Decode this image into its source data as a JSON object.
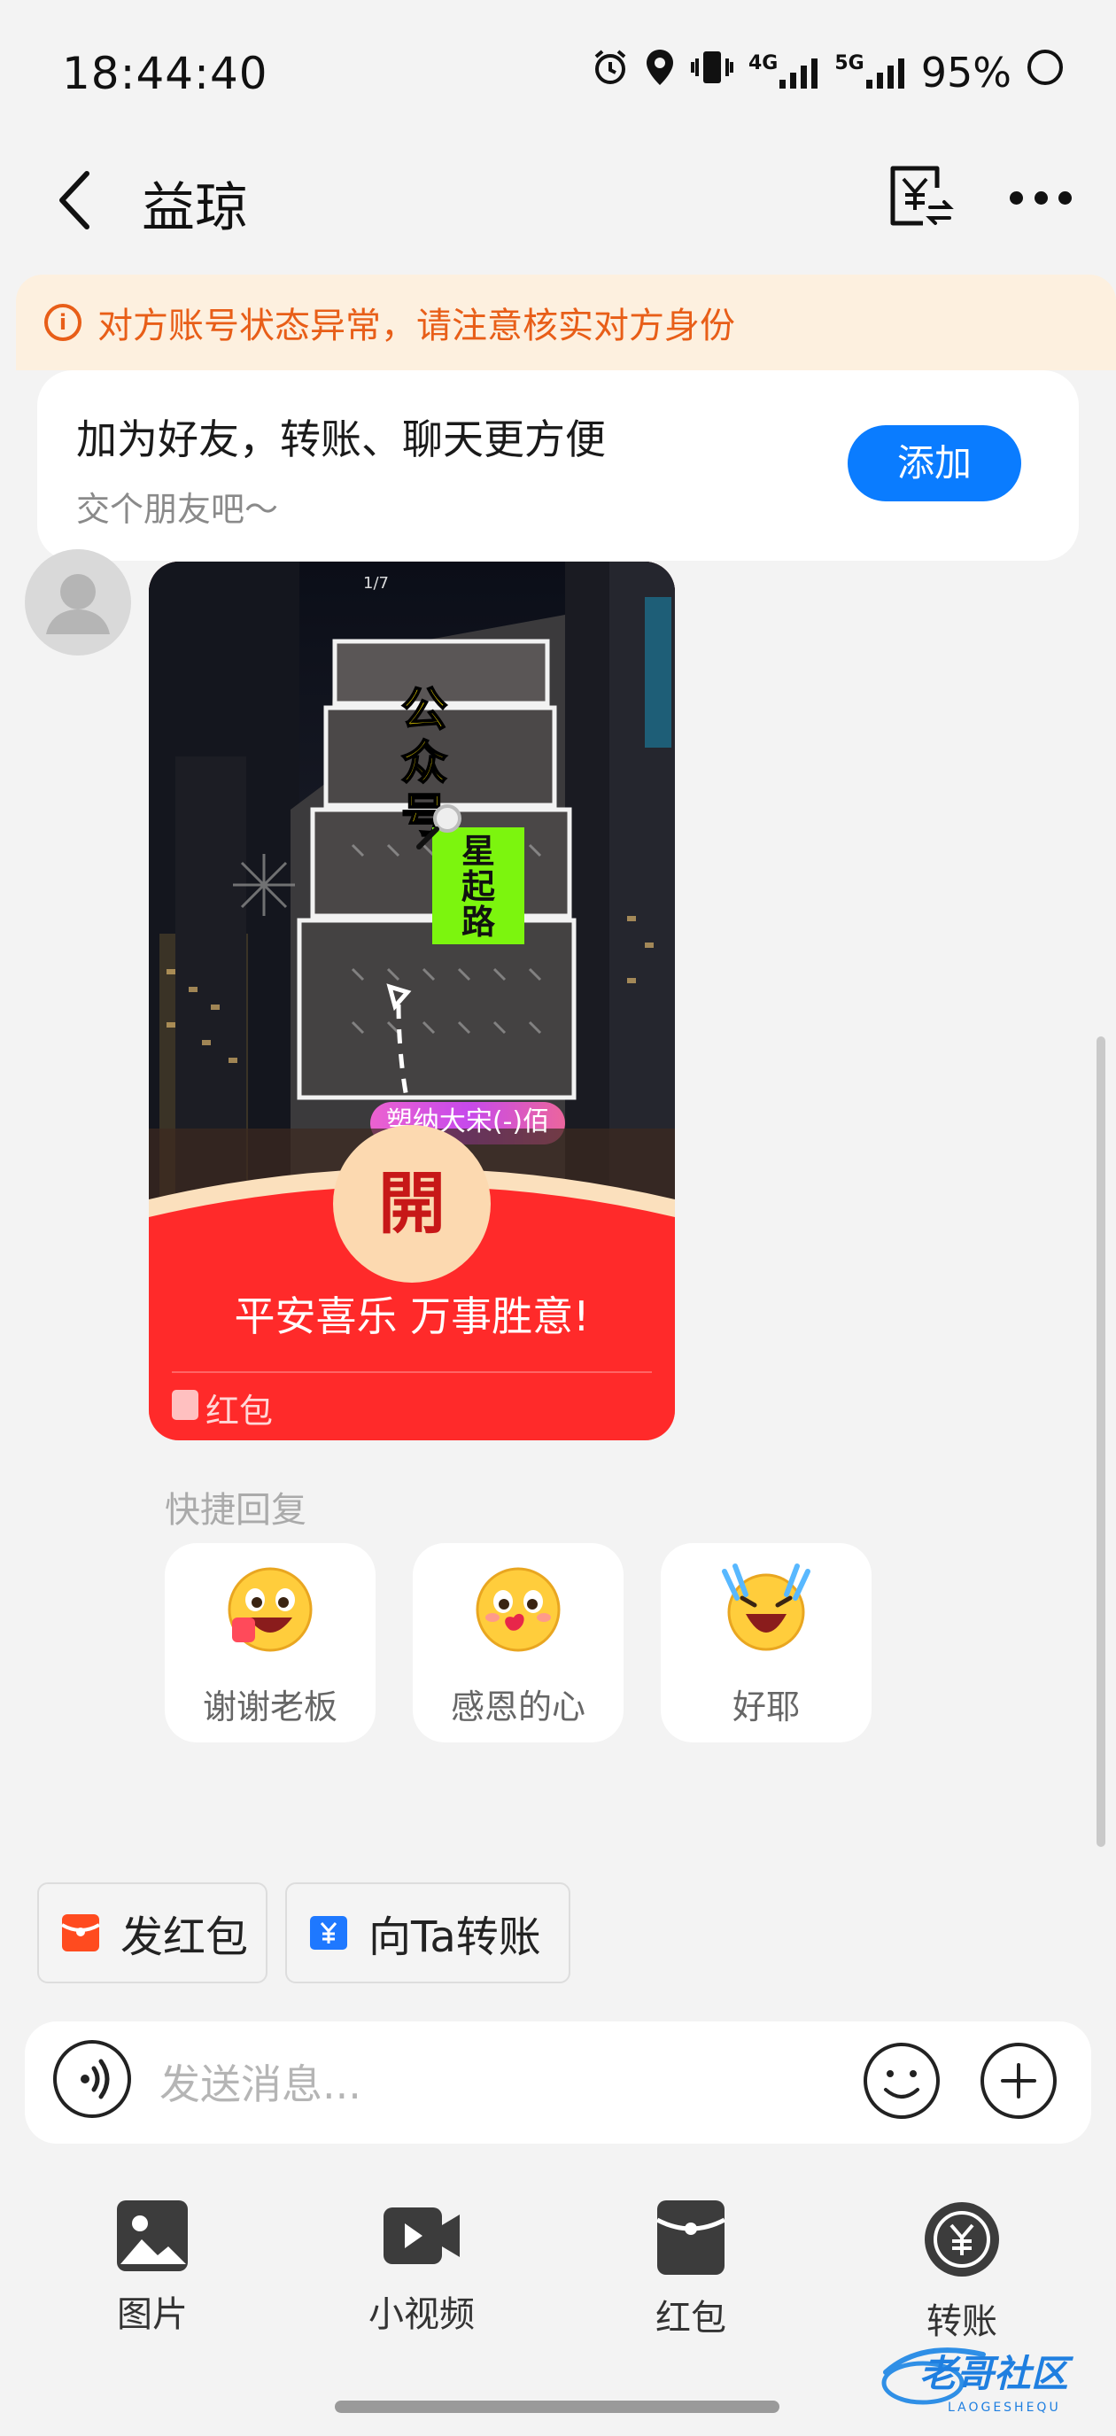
{
  "status_bar": {
    "time": "18:44:40",
    "battery_percent": "95%",
    "network_1": "4G",
    "network_2": "5G",
    "icons": [
      "alarm-icon",
      "location-icon",
      "vibrate-icon",
      "signal-4g-icon",
      "signal-5g-icon",
      "battery-icon"
    ]
  },
  "header": {
    "title": "益琼",
    "icons": [
      "back-arrow-icon",
      "transfer-receipt-icon",
      "more-dots-icon"
    ]
  },
  "warning": {
    "text": "对方账号状态异常，请注意核实对方身份",
    "icon_glyph": "i",
    "color": "#e85e18"
  },
  "friend_card": {
    "title": "加为好友，转账、聊天更方便",
    "subtitle": "交个朋友吧～",
    "button": "添加",
    "button_color": "#0a7cff"
  },
  "red_packet": {
    "page_indicator": "1/7",
    "overlay_vertical_1": "公众号",
    "overlay_vertical_2": "星起路",
    "neon_text": "塑纳大宋(-)佰",
    "open_glyph": "開",
    "wish": "平安喜乐 万事胜意!",
    "label": "红包",
    "color": "#ff2a2a"
  },
  "quick_reply": {
    "title": "快捷回复",
    "items": [
      {
        "label": "谢谢老板",
        "icon": "grinning-thanks-emoji-icon"
      },
      {
        "label": "感恩的心",
        "icon": "grateful-heart-emoji-icon"
      },
      {
        "label": "好耶",
        "icon": "cheering-emoji-icon"
      }
    ]
  },
  "actions": {
    "send_red_packet": "发红包",
    "transfer_to_ta": "向Ta转账"
  },
  "input": {
    "placeholder": "发送消息..."
  },
  "toolbar": {
    "items": [
      {
        "label": "图片",
        "icon": "image-icon"
      },
      {
        "label": "小视频",
        "icon": "video-icon"
      },
      {
        "label": "红包",
        "icon": "red-packet-icon"
      },
      {
        "label": "转账",
        "icon": "transfer-yuan-icon"
      }
    ]
  },
  "watermark": {
    "text": "老哥社区",
    "subtext": "LAOGESHEQU"
  }
}
